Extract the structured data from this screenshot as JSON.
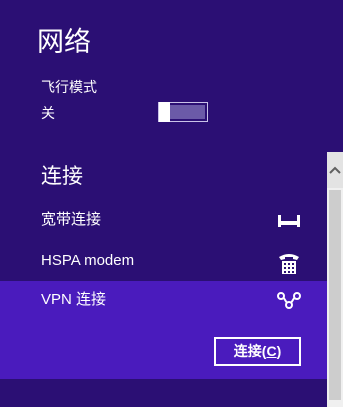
{
  "panel": {
    "title": "网络",
    "airplane_mode": {
      "label": "飞行模式",
      "state": "关",
      "on": false
    },
    "section_title": "连接",
    "connections": [
      {
        "name": "宽带连接",
        "icon": "ethernet-icon"
      },
      {
        "name": "HSPA modem",
        "icon": "telephone-icon"
      },
      {
        "name": "VPN 连接",
        "icon": "vpn-icon",
        "selected": true
      }
    ],
    "connect_button": {
      "label": "连接(",
      "mnemonic": "C",
      "close": ")"
    }
  },
  "colors": {
    "background": "#2b0f74",
    "selected": "#4a1bbd",
    "text": "#ffffff"
  }
}
